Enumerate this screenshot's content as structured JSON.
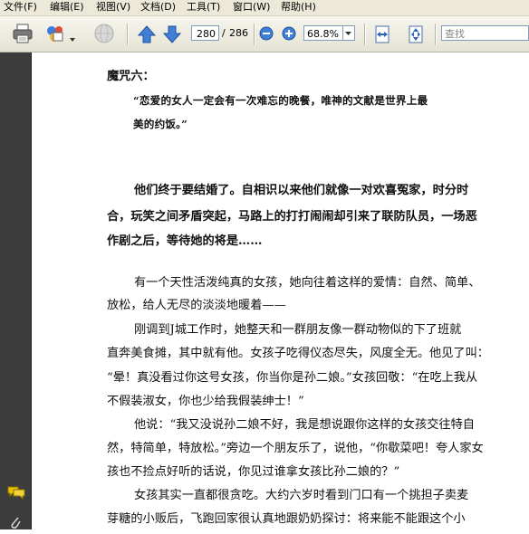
{
  "menu": [
    "文件(F)",
    "编辑(E)",
    "视图(V)",
    "文档(D)",
    "工具(T)",
    "窗口(W)",
    "帮助(H)"
  ],
  "toolbar": {
    "page_current": "280",
    "page_separator": "/",
    "page_total": "286",
    "zoom": "68.8%",
    "search_placeholder": "查找",
    "icons": [
      "print-icon",
      "share-icon",
      "web-icon",
      "up-arrow-icon",
      "down-arrow-icon",
      "zoom-out-icon",
      "zoom-in-icon",
      "fit-width-icon",
      "fit-page-icon"
    ]
  },
  "document": {
    "heading": "魔咒六：",
    "quote_line1": "“恋爱的女人一定会有一次难忘的晚餐，唯神的文献是世界上最",
    "quote_line2": "美的约饭。”",
    "bold_line1": "他们终于要结婚了。自相识以来他们就像一对欢喜冤家，时分时",
    "bold_line2": "合，玩笑之间矛盾突起，马路上的打打闹闹却引来了联防队员，一场恶",
    "bold_line3": "作剧之后，等待她的将是……",
    "p1_line1": "有一个天性活泼纯真的女孩，她向往着这样的爱情：自然、简单、",
    "p1_line2": "放松，给人无尽的淡淡地暖着——",
    "p2_line1": "刚调到J城工作时，她整天和一群朋友像一群动物似的下了班就",
    "p2_line2": "直奔美食摊，其中就有他。女孩子吃得仪态尽失，风度全无。他见了叫：",
    "p2_line3": "“晕！真没看过你这号女孩，你当你是孙二娘。”女孩回敬：“在吃上我从",
    "p2_line4": "不假装淑女，你也少给我假装绅士！”",
    "p3_line1": "他说：“我又没说孙二娘不好，我是想说跟你这样的女孩交往特自",
    "p3_line2": "然，特简单，特放松。”旁边一个朋友乐了，说他，“你歇菜吧！夸人家女",
    "p3_line3": "孩也不捡点好听的话说，你见过谁拿女孩比孙二娘的？”",
    "p4_line1": "女孩其实一直都很贪吃。大约六岁时看到门口有一个挑担子卖麦",
    "p4_line2": "芽糖的小贩后，飞跑回家很认真地跟奶奶探讨：将来能不能跟这个小"
  }
}
